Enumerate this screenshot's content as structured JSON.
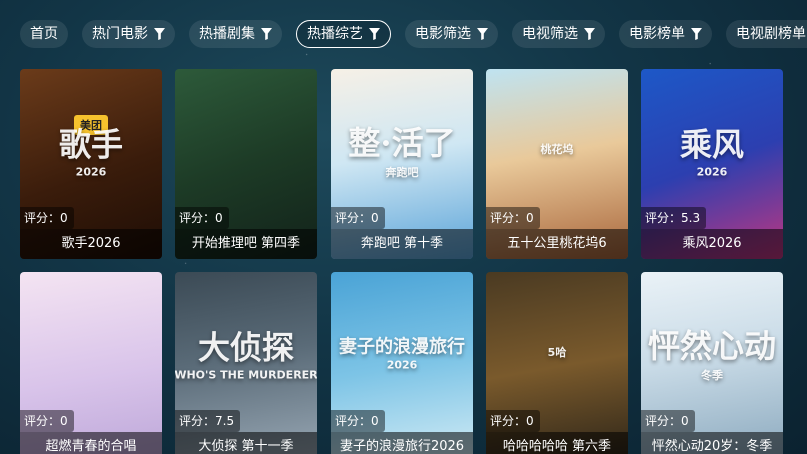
{
  "tabs": [
    {
      "label": "首页",
      "filter": false,
      "active": false
    },
    {
      "label": "热门电影",
      "filter": true,
      "active": false
    },
    {
      "label": "热播剧集",
      "filter": true,
      "active": false
    },
    {
      "label": "热播综艺",
      "filter": true,
      "active": true
    },
    {
      "label": "电影筛选",
      "filter": true,
      "active": false
    },
    {
      "label": "电视筛选",
      "filter": true,
      "active": false
    },
    {
      "label": "电影榜单",
      "filter": true,
      "active": false
    },
    {
      "label": "电视剧榜单",
      "filter": true,
      "active": false
    }
  ],
  "score_prefix": "评分：",
  "cards": [
    {
      "title": "歌手2026",
      "score": "0",
      "poster_text": "歌手",
      "poster_sub": "2026",
      "badge": "美团"
    },
    {
      "title": "开始推理吧 第四季",
      "score": "0",
      "poster_text": "",
      "poster_sub": "",
      "badge": ""
    },
    {
      "title": "奔跑吧 第十季",
      "score": "0",
      "poster_text": "整·活了",
      "poster_sub": "奔跑吧",
      "badge": ""
    },
    {
      "title": "五十公里桃花坞6",
      "score": "0",
      "poster_text": "",
      "poster_sub": "桃花坞",
      "badge": ""
    },
    {
      "title": "乘风2026",
      "score": "5.3",
      "poster_text": "乘风",
      "poster_sub": "2026",
      "badge": ""
    },
    {
      "title": "超燃青春的合唱",
      "score": "0",
      "poster_text": "",
      "poster_sub": "",
      "badge": ""
    },
    {
      "title": "大侦探 第十一季",
      "score": "7.5",
      "poster_text": "大侦探",
      "poster_sub": "WHO'S THE MURDERER",
      "badge": ""
    },
    {
      "title": "妻子的浪漫旅行2026",
      "score": "0",
      "poster_text": "妻子的浪漫旅行",
      "poster_sub": "2026",
      "badge": ""
    },
    {
      "title": "哈哈哈哈哈 第六季",
      "score": "0",
      "poster_text": "",
      "poster_sub": "5哈",
      "badge": ""
    },
    {
      "title": "怦然心动20岁：冬季",
      "score": "0",
      "poster_text": "怦然心动",
      "poster_sub": "冬季",
      "badge": ""
    }
  ]
}
